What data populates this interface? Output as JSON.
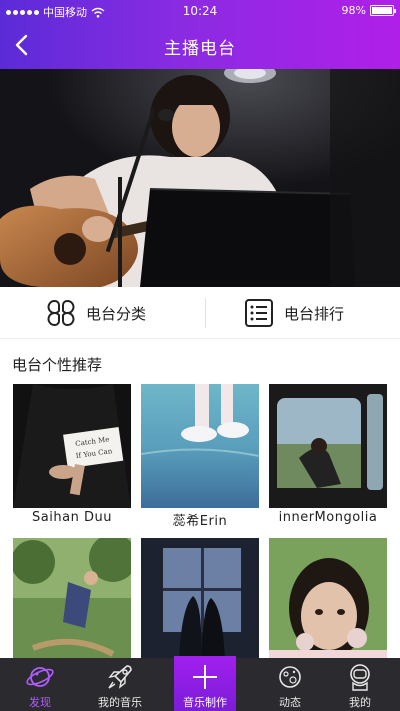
{
  "status_bar": {
    "carrier": "中国移动",
    "time": "10:24",
    "battery_text": "98%",
    "battery_level": 0.98
  },
  "nav": {
    "title": "主播电台",
    "back_icon": "chevron-left-icon"
  },
  "banner": {
    "description_icon": "banner-photo"
  },
  "entries": [
    {
      "label": "电台分类",
      "icon": "category-grid-icon"
    },
    {
      "label": "电台排行",
      "icon": "ranking-list-icon"
    }
  ],
  "section": {
    "title": "电台个性推荐"
  },
  "recommendations": [
    {
      "caption": "Saihan Duu",
      "card_text_1": "Catch Me",
      "card_text_2": "If You Can"
    },
    {
      "caption": "蕊希Erin"
    },
    {
      "caption": "innerMongolia"
    },
    {
      "caption": ""
    },
    {
      "caption": ""
    },
    {
      "caption": ""
    }
  ],
  "tabbar": {
    "tabs": [
      {
        "label": "发现",
        "icon": "planet-icon",
        "active": true
      },
      {
        "label": "我的音乐",
        "icon": "rocket-icon",
        "active": false
      },
      {
        "label": "音乐制作",
        "icon": "plus-icon",
        "active": false
      },
      {
        "label": "动态",
        "icon": "planet-ring-icon",
        "active": false
      },
      {
        "label": "我的",
        "icon": "astronaut-icon",
        "active": false
      }
    ]
  },
  "colors": {
    "header_start": "#5b2bd8",
    "header_end": "#b01fe8",
    "tabbar_bg": "#2b2b2f",
    "tab_active": "#b05cff",
    "center_tab": "#a21ff0"
  }
}
